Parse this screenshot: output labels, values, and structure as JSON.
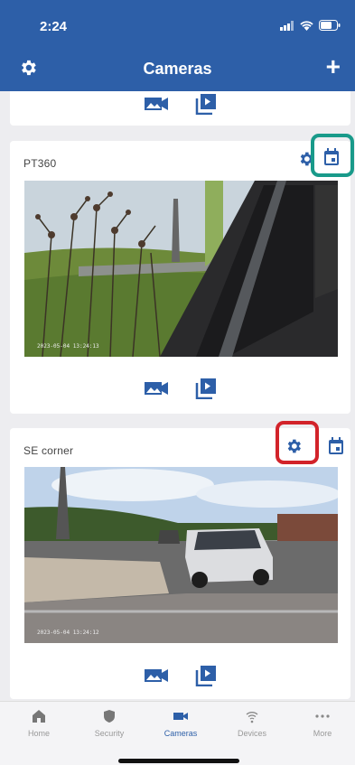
{
  "status": {
    "time": "2:24"
  },
  "header": {
    "title": "Cameras",
    "add_label": "+"
  },
  "cameras": [
    {
      "name": "PT360",
      "timestamp": "2023-05-04 13:24:13"
    },
    {
      "name": "SE corner",
      "timestamp": "2023-05-04 13:24:12"
    }
  ],
  "tabs": [
    {
      "label": "Home",
      "icon": "home-icon"
    },
    {
      "label": "Security",
      "icon": "shield-icon"
    },
    {
      "label": "Cameras",
      "icon": "video-camera-icon"
    },
    {
      "label": "Devices",
      "icon": "wifi-icon"
    },
    {
      "label": "More",
      "icon": "more-icon"
    }
  ],
  "colors": {
    "brand": "#2d5fa8",
    "highlight_teal": "#199a8a",
    "highlight_red": "#d2232a"
  }
}
